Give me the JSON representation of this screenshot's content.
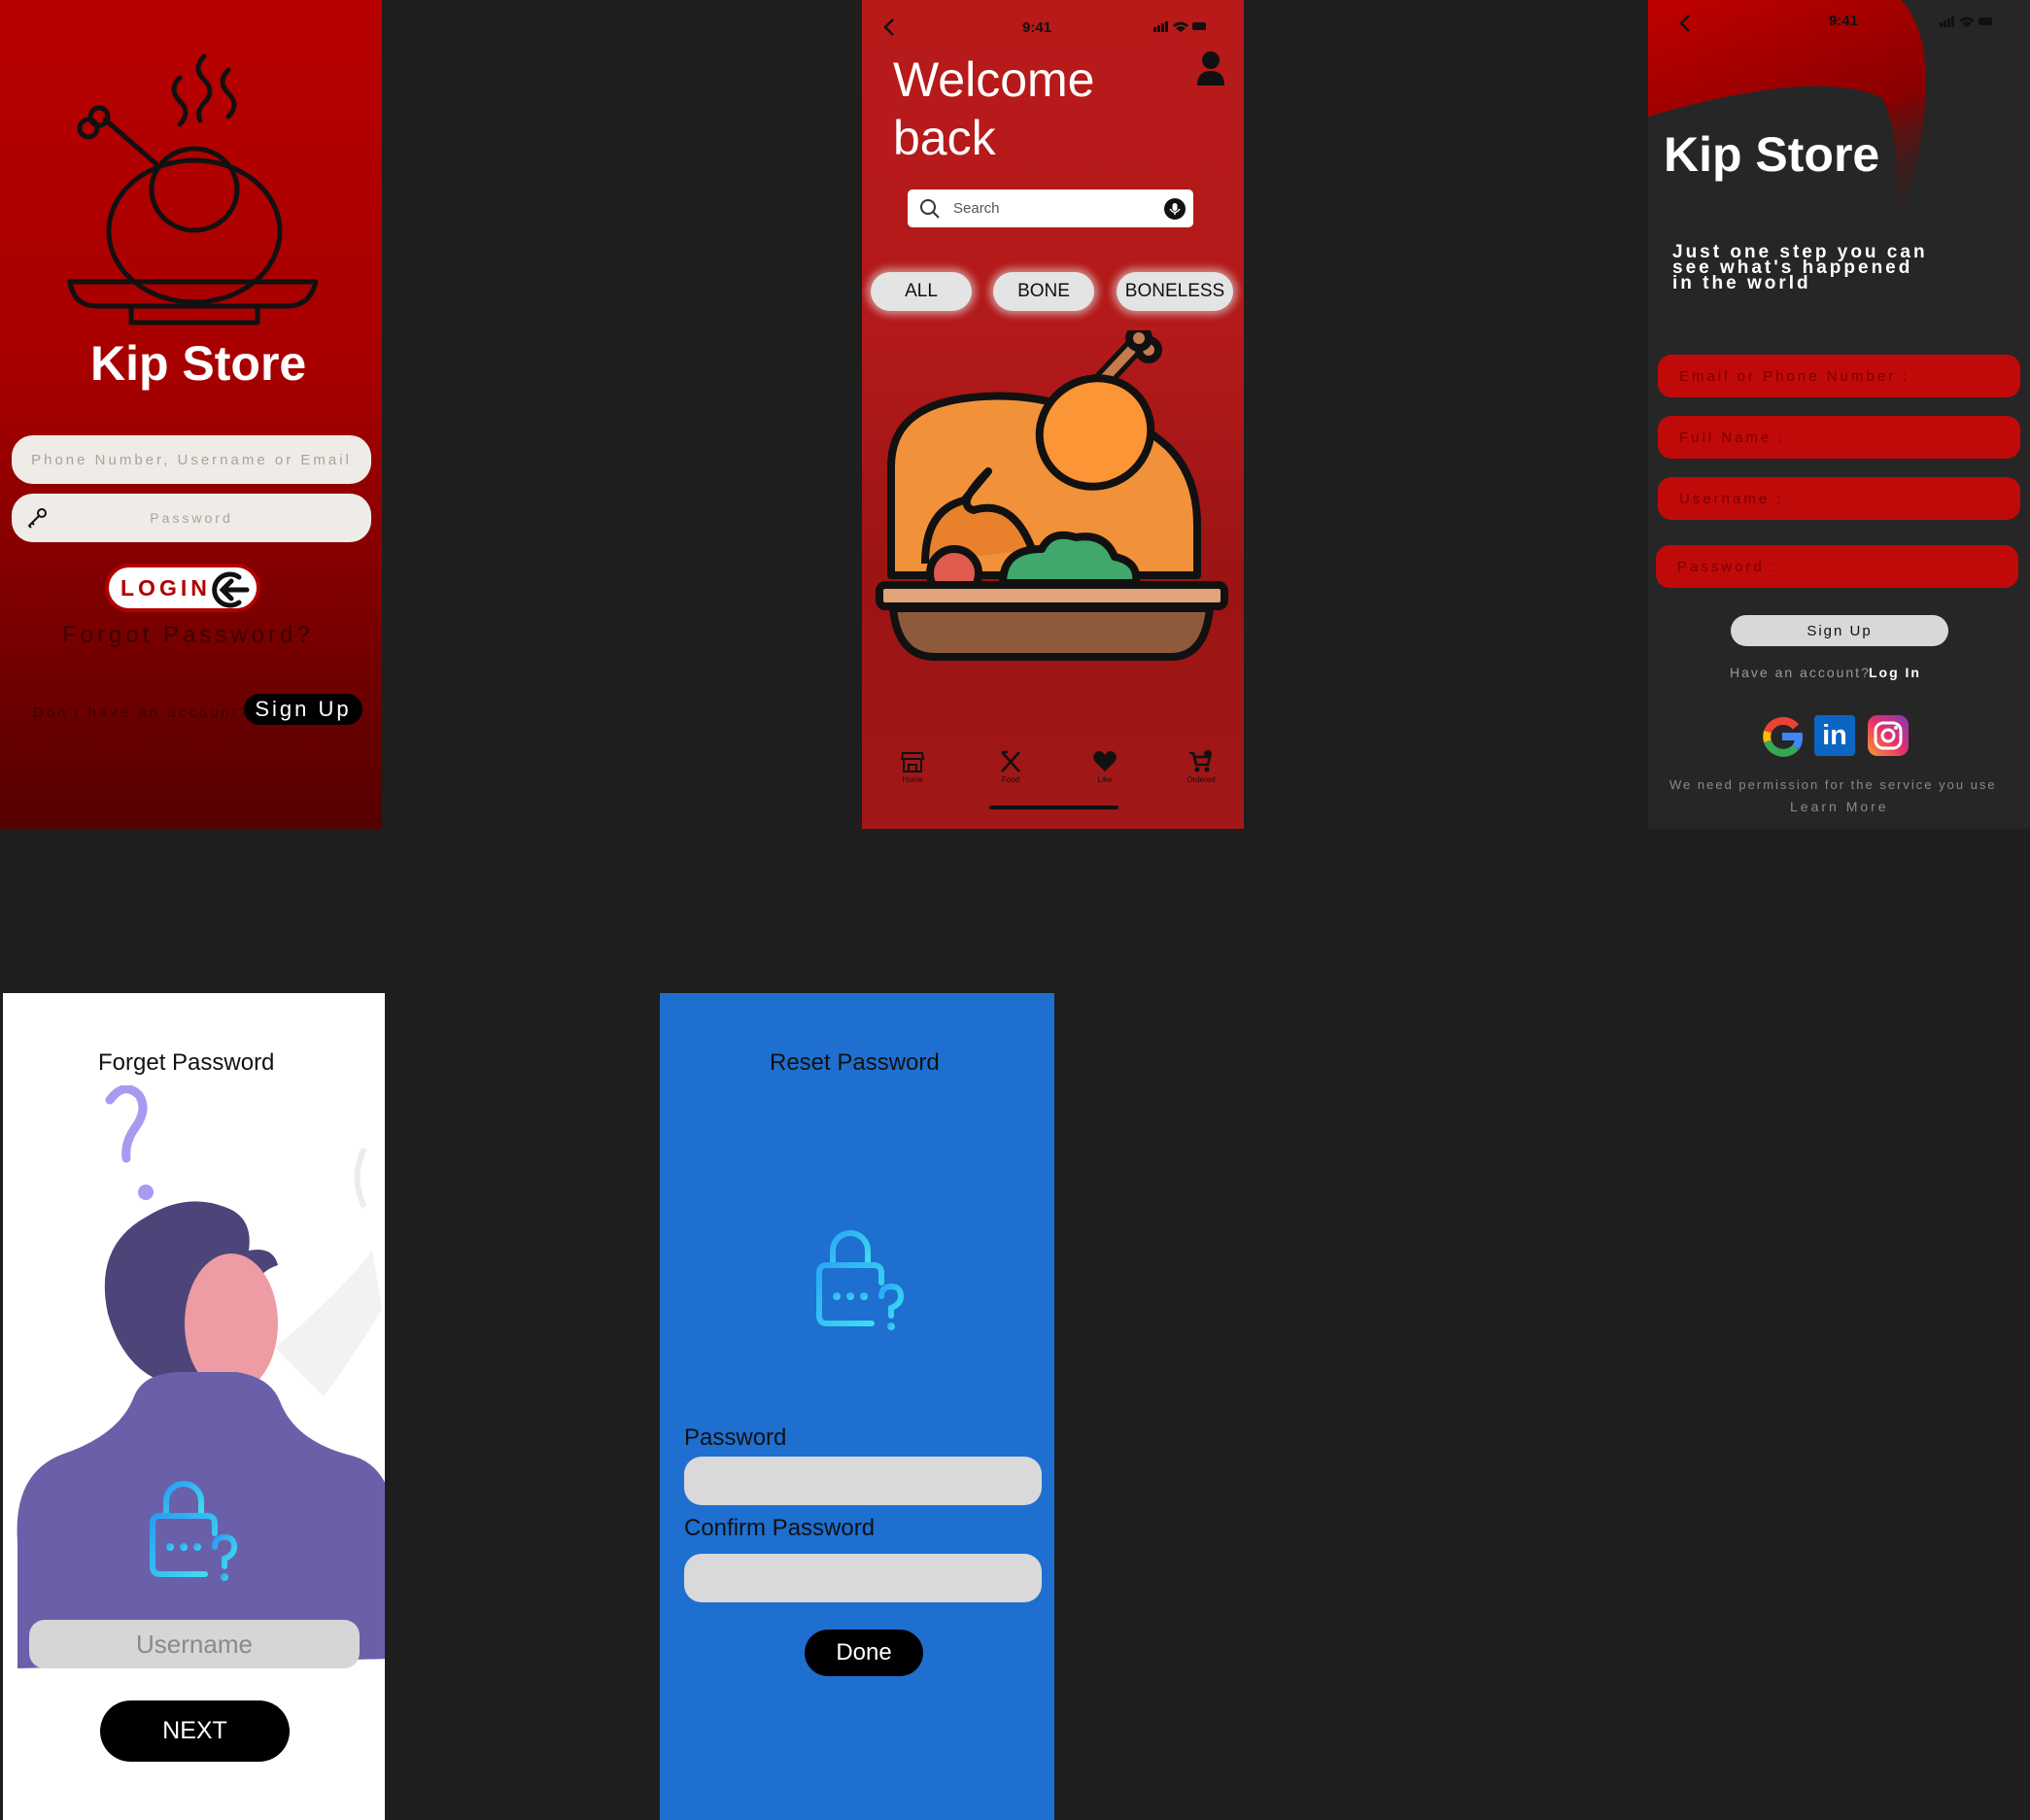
{
  "login": {
    "brand": "Kip Store",
    "identifier_placeholder": "Phone Number, Username or Email",
    "password_placeholder": "Password",
    "login_label": "LOGIN",
    "forgot_label": "Forgot Password?",
    "no_account_text": "Don't have an account?",
    "signup_label": "Sign Up"
  },
  "home": {
    "status_time": "9:41",
    "greeting": "Welcome back",
    "search_placeholder": "Search",
    "filters": [
      "ALL",
      "BONE",
      "BONELESS"
    ],
    "nav": [
      "Home",
      "Food",
      "Like",
      "Ordered"
    ]
  },
  "signup": {
    "status_time": "9:41",
    "brand": "Kip Store",
    "tagline_lines": [
      "Just one step you can",
      "see what's happened",
      "in the world"
    ],
    "fields": [
      "Email or Phone Number :",
      "Full Name :",
      "Username :",
      "Password :"
    ],
    "signup_button": "Sign Up",
    "have_account_text": "Have an account?",
    "login_link": "Log In",
    "permission_text": "We need permission for the service you use",
    "learn_more": "Learn More"
  },
  "forget": {
    "title": "Forget Password",
    "username_placeholder": "Username",
    "next_label": "NEXT"
  },
  "reset": {
    "title": "Reset Password",
    "password_label": "Password",
    "confirm_label": "Confirm Password",
    "done_label": "Done"
  },
  "colors": {
    "brand_red": "#b80000",
    "reset_blue": "#1e6fcf",
    "dark_bg": "#1e1e1e"
  }
}
